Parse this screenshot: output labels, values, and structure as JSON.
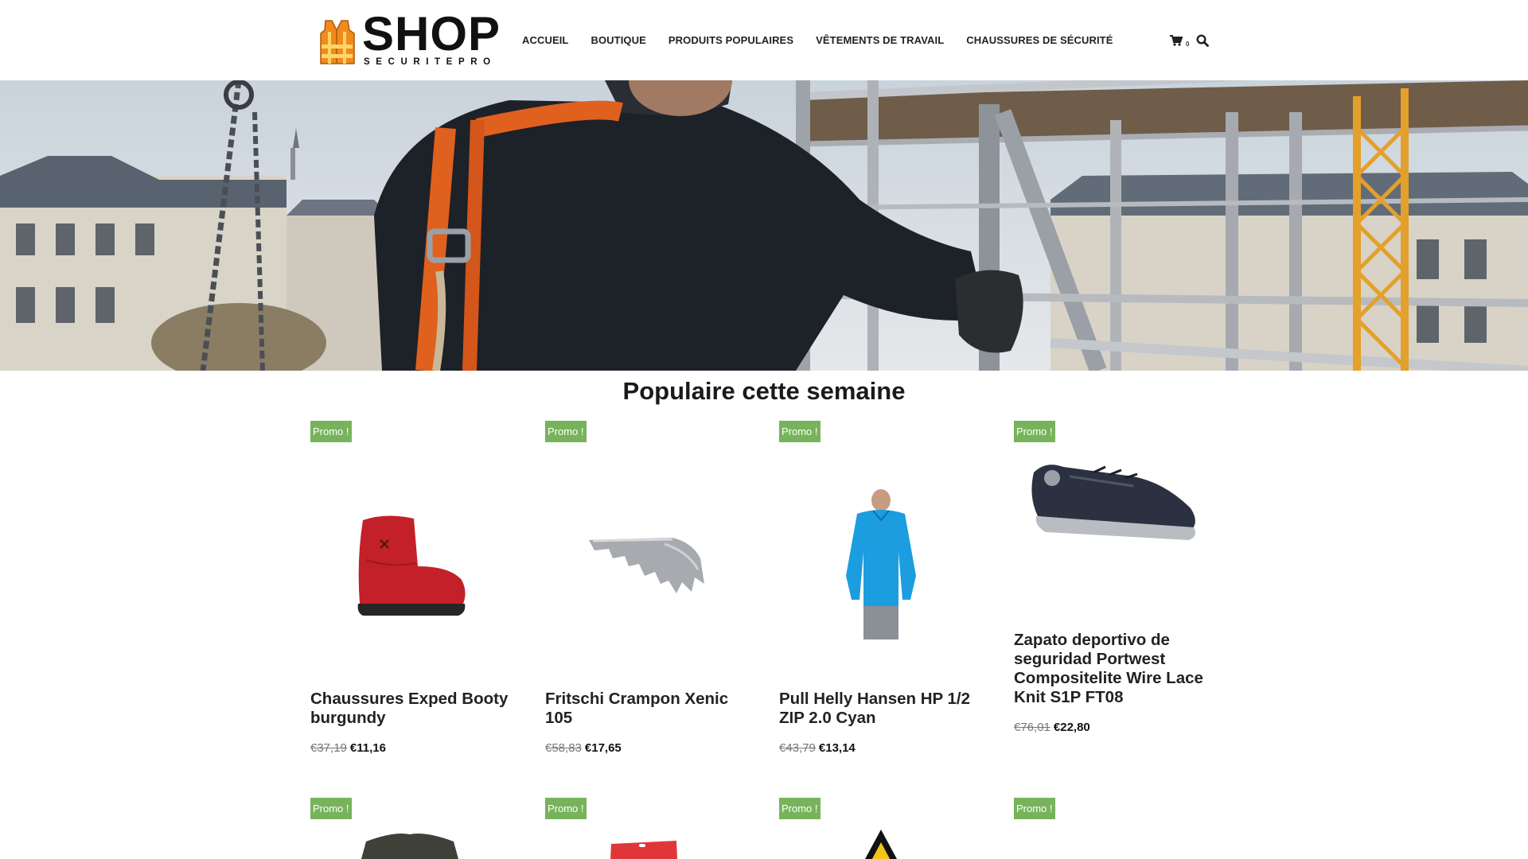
{
  "header": {
    "logo": {
      "title": "SHOP",
      "subtitle": "SECURITEPRO"
    },
    "nav": [
      {
        "label": "ACCUEIL"
      },
      {
        "label": "BOUTIQUE"
      },
      {
        "label": "PRODUITS POPULAIRES"
      },
      {
        "label": "VÊTEMENTS DE TRAVAIL"
      },
      {
        "label": "CHAUSSURES DE SÉCURITÉ"
      }
    ],
    "cart_count": "0",
    "icons": {
      "cart": "cart-icon",
      "search": "search-icon"
    }
  },
  "section": {
    "title": "Populaire cette semaine"
  },
  "products": [
    {
      "badge": "Promo !",
      "name": "Chaussures Exped Booty burgundy",
      "old_price": "€37,19",
      "price": "€11,16"
    },
    {
      "badge": "Promo !",
      "name": "Fritschi Crampon Xenic 105",
      "old_price": "€58,83",
      "price": "€17,65"
    },
    {
      "badge": "Promo !",
      "name": "Pull Helly Hansen HP 1/2 ZIP 2.0 Cyan",
      "old_price": "€43,79",
      "price": "€13,14"
    },
    {
      "badge": "Promo !",
      "name": "Zapato deportivo de seguridad Portwest Compositelite Wire Lace Knit S1P FT08",
      "old_price": "€76,01",
      "price": "€22,80"
    },
    {
      "badge": "Promo !"
    },
    {
      "badge": "Promo !"
    },
    {
      "badge": "Promo !"
    },
    {
      "badge": "Promo !"
    }
  ],
  "colors": {
    "promo_badge": "#77b35a",
    "vest_orange": "#f08a1c",
    "text": "#222222"
  }
}
